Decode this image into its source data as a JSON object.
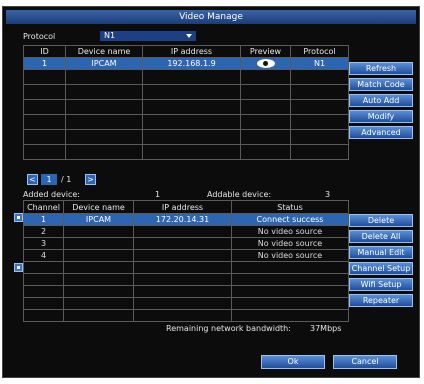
{
  "title": "Video Manage",
  "protocol_label": "Protocol",
  "protocol_value": "N1",
  "device_table": {
    "headers": [
      "ID",
      "Device name",
      "IP address",
      "Preview",
      "Protocol"
    ],
    "rows": [
      {
        "id": "1",
        "name": "IPCAM",
        "ip": "192.168.1.9",
        "preview": "eye-icon",
        "protocol": "N1"
      }
    ]
  },
  "right_buttons": [
    "Refresh",
    "Match Code",
    "Auto Add",
    "Modify",
    "Advanced"
  ],
  "pager": {
    "prev": "<",
    "current": "1",
    "total": "/ 1",
    "next": ">"
  },
  "added_label": "Added device:",
  "added_count": "1",
  "addable_label": "Addable device:",
  "addable_count": "3",
  "channel_table": {
    "headers": [
      "Channel",
      "Device name",
      "IP address",
      "Status"
    ],
    "rows": [
      {
        "ch": "1",
        "name": "IPCAM",
        "ip": "172.20.14.31",
        "status": "Connect success"
      },
      {
        "ch": "2",
        "name": "",
        "ip": "",
        "status": "No video source"
      },
      {
        "ch": "3",
        "name": "",
        "ip": "",
        "status": "No video source"
      },
      {
        "ch": "4",
        "name": "",
        "ip": "",
        "status": "No video source"
      }
    ]
  },
  "channel_buttons": [
    "Delete",
    "Delete All",
    "Manual Edit",
    "Channel Setup",
    "Wifi Setup",
    "Repeater"
  ],
  "bandwidth_label": "Remaining network bandwidth:",
  "bandwidth_value": "37Mbps",
  "ok_label": "Ok",
  "cancel_label": "Cancel",
  "colors": {
    "accent": "#2a66b4",
    "title_bar": "#1c3d7a",
    "background": "#0c0c0c"
  }
}
